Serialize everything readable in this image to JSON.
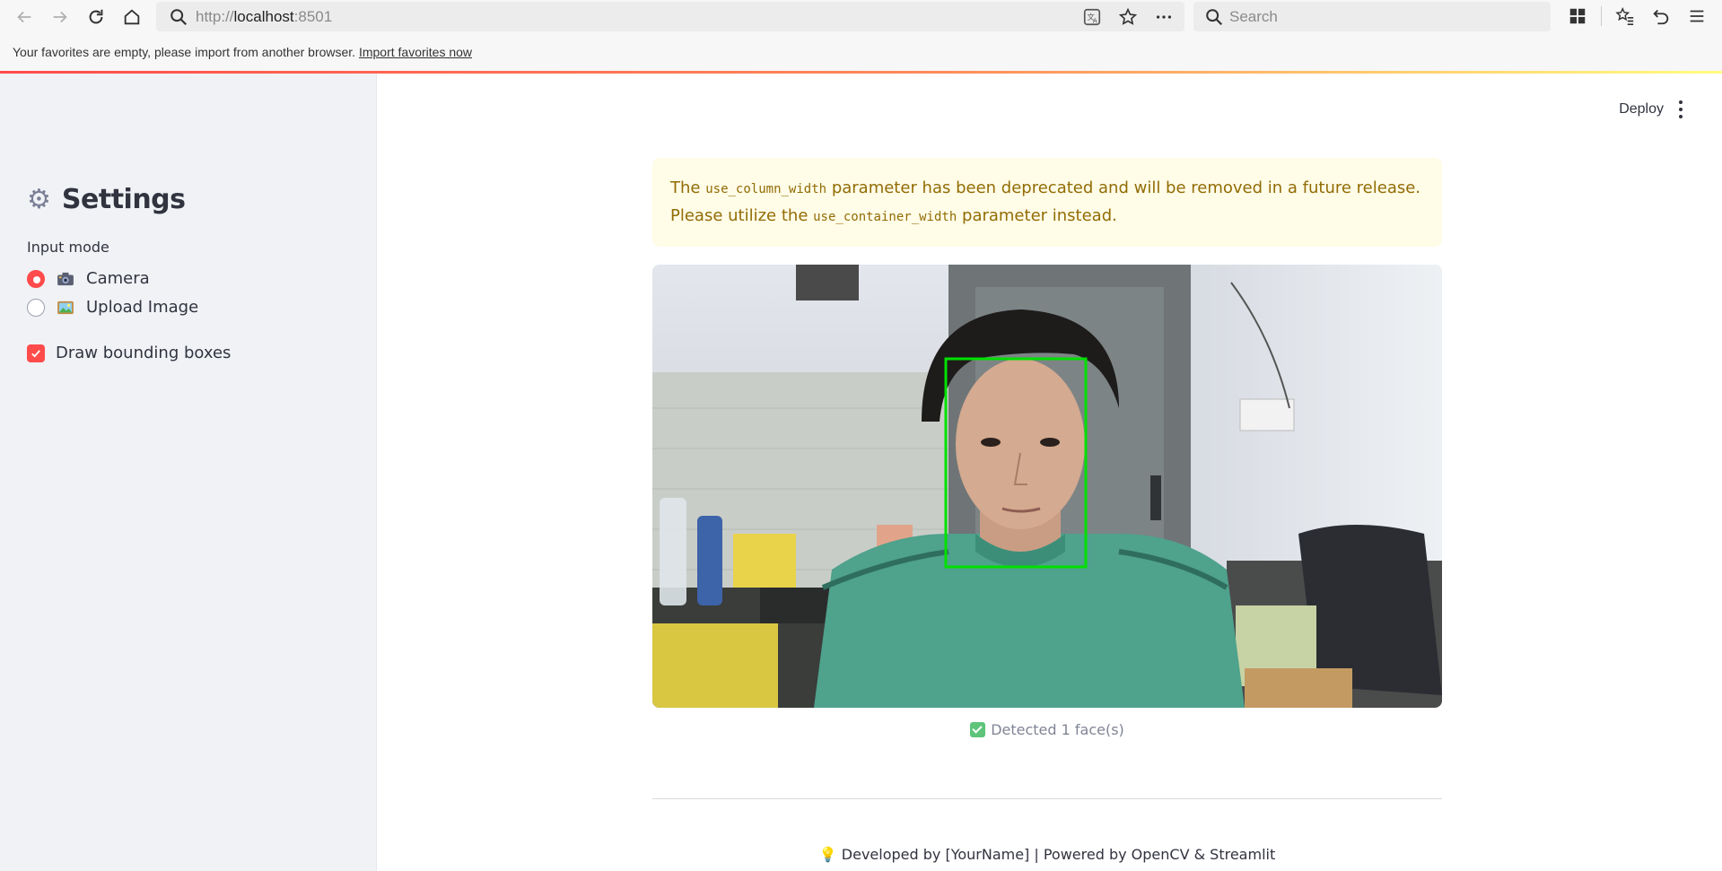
{
  "browser": {
    "url_prefix": "http://",
    "url_host": "localhost",
    "url_port": ":8501",
    "search_placeholder": "Search",
    "favorites_message": "Your favorites are empty, please import from another browser.",
    "favorites_link": "Import favorites now"
  },
  "sidebar": {
    "title": "Settings",
    "title_icon": "gear-icon",
    "input_mode_label": "Input mode",
    "options": [
      {
        "label": "Camera",
        "icon": "camera-emoji-icon",
        "selected": true
      },
      {
        "label": "Upload Image",
        "icon": "picture-emoji-icon",
        "selected": false
      }
    ],
    "draw_boxes_label": "Draw bounding boxes",
    "draw_boxes_checked": true
  },
  "header": {
    "deploy_label": "Deploy"
  },
  "warning": {
    "text_1": "The",
    "code_1": "use_column_width",
    "text_2": "parameter has been deprecated and will be removed in a future release. Please utilize the",
    "code_2": "use_container_width",
    "text_3": "parameter instead."
  },
  "detection": {
    "status": "Detected 1 face(s)",
    "box_color": "#00e000"
  },
  "footer": {
    "text": "Developed by [YourName] | Powered by OpenCV & Streamlit",
    "icon": "lightbulb-icon"
  },
  "colors": {
    "accent": "#ff4b4b",
    "warning_bg": "#fffce7",
    "warning_text": "#926c05",
    "sidebar_bg": "#f0f2f6"
  }
}
